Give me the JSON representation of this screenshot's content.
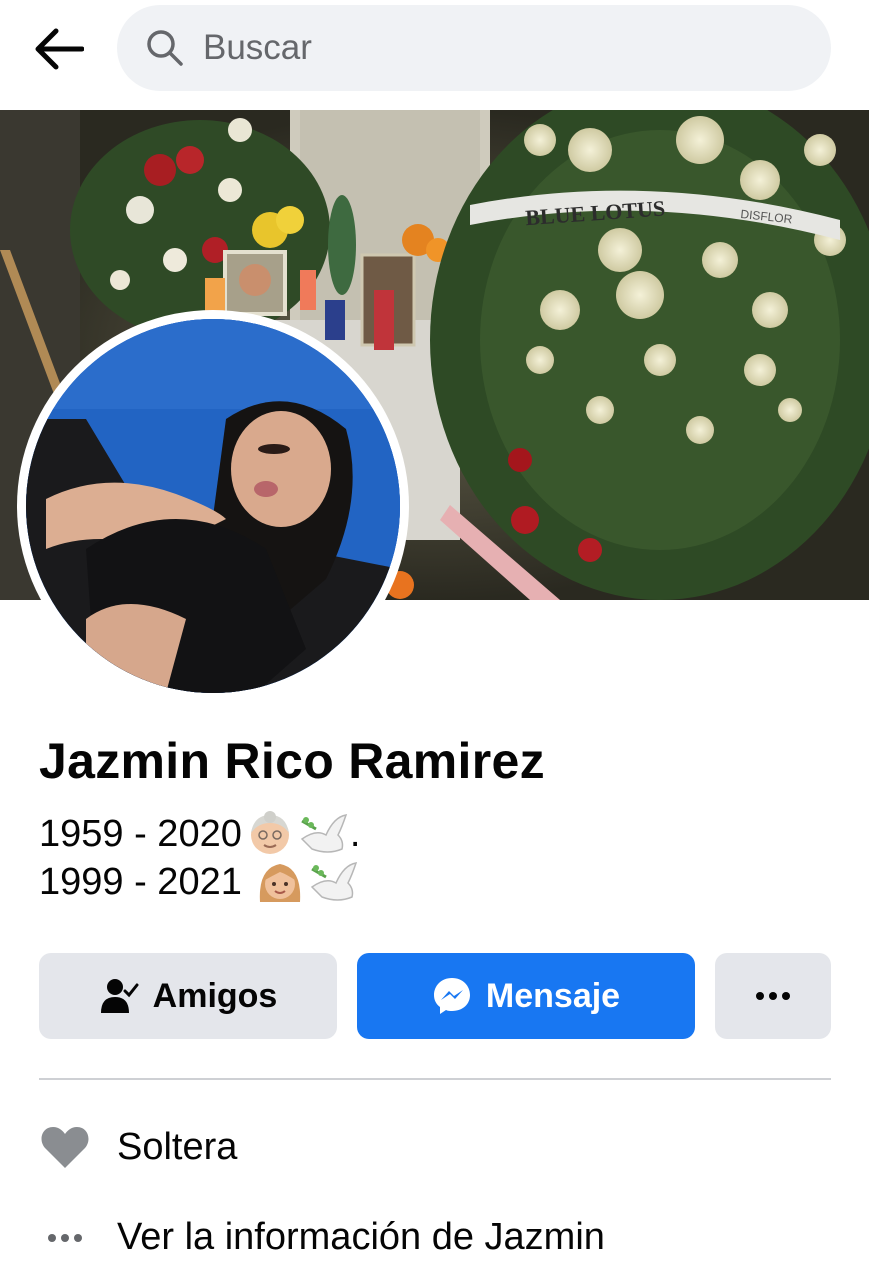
{
  "header": {
    "back_icon": "arrow-left-icon",
    "search": {
      "placeholder": "Buscar",
      "icon": "search-icon"
    }
  },
  "cover": {
    "description_icon": "cover-photo",
    "ribbon_text": "BLUE LOTUS",
    "ribbon_brand": "DISFLOR"
  },
  "profile": {
    "name": "Jazmin Rico Ramirez",
    "bio": [
      {
        "text": "1959 - 2020",
        "emojis": [
          "old-woman-emoji",
          "dove-emoji"
        ],
        "suffix": "."
      },
      {
        "text": "1999 - 2021 ",
        "emojis": [
          "woman-emoji",
          "dove-emoji"
        ],
        "suffix": ""
      }
    ]
  },
  "actions": {
    "friends_label": "Amigos",
    "message_label": "Mensaje",
    "more_icon": "more-dots-icon"
  },
  "info": {
    "relationship": "Soltera",
    "see_info": "Ver la información de Jazmin"
  },
  "colors": {
    "accent": "#1877f2",
    "secondary_button": "#e4e6eb",
    "search_bg": "#f0f2f5",
    "divider": "#ced0d4",
    "icon_gray": "#65676b"
  }
}
